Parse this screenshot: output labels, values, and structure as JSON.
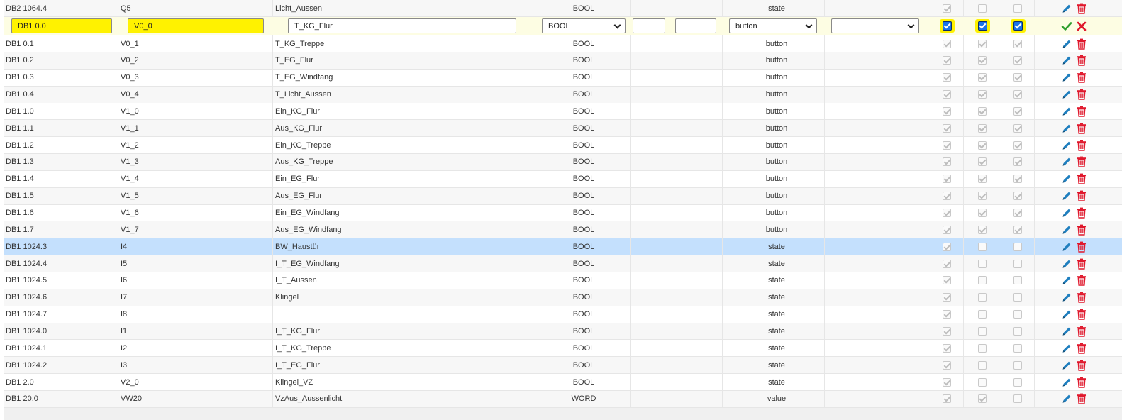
{
  "rows": [
    {
      "addr": "DB2 1064.4",
      "name": "Q5",
      "desc": "Licht_Aussen",
      "type": "BOOL",
      "kind": "state",
      "c1": true,
      "c2": false,
      "c3": false
    },
    {
      "addr": "DB1 0.1",
      "name": "V0_1",
      "desc": "T_KG_Treppe",
      "type": "BOOL",
      "kind": "button",
      "c1": true,
      "c2": true,
      "c3": true
    },
    {
      "addr": "DB1 0.2",
      "name": "V0_2",
      "desc": "T_EG_Flur",
      "type": "BOOL",
      "kind": "button",
      "c1": true,
      "c2": true,
      "c3": true
    },
    {
      "addr": "DB1 0.3",
      "name": "V0_3",
      "desc": "T_EG_Windfang",
      "type": "BOOL",
      "kind": "button",
      "c1": true,
      "c2": true,
      "c3": true
    },
    {
      "addr": "DB1 0.4",
      "name": "V0_4",
      "desc": "T_Licht_Aussen",
      "type": "BOOL",
      "kind": "button",
      "c1": true,
      "c2": true,
      "c3": true
    },
    {
      "addr": "DB1 1.0",
      "name": "V1_0",
      "desc": "Ein_KG_Flur",
      "type": "BOOL",
      "kind": "button",
      "c1": true,
      "c2": true,
      "c3": true
    },
    {
      "addr": "DB1 1.1",
      "name": "V1_1",
      "desc": "Aus_KG_Flur",
      "type": "BOOL",
      "kind": "button",
      "c1": true,
      "c2": true,
      "c3": true
    },
    {
      "addr": "DB1 1.2",
      "name": "V1_2",
      "desc": "Ein_KG_Treppe",
      "type": "BOOL",
      "kind": "button",
      "c1": true,
      "c2": true,
      "c3": true
    },
    {
      "addr": "DB1 1.3",
      "name": "V1_3",
      "desc": "Aus_KG_Treppe",
      "type": "BOOL",
      "kind": "button",
      "c1": true,
      "c2": true,
      "c3": true
    },
    {
      "addr": "DB1 1.4",
      "name": "V1_4",
      "desc": "Ein_EG_Flur",
      "type": "BOOL",
      "kind": "button",
      "c1": true,
      "c2": true,
      "c3": true
    },
    {
      "addr": "DB1 1.5",
      "name": "V1_5",
      "desc": "Aus_EG_Flur",
      "type": "BOOL",
      "kind": "button",
      "c1": true,
      "c2": true,
      "c3": true
    },
    {
      "addr": "DB1 1.6",
      "name": "V1_6",
      "desc": "Ein_EG_Windfang",
      "type": "BOOL",
      "kind": "button",
      "c1": true,
      "c2": true,
      "c3": true
    },
    {
      "addr": "DB1 1.7",
      "name": "V1_7",
      "desc": "Aus_EG_Windfang",
      "type": "BOOL",
      "kind": "button",
      "c1": true,
      "c2": true,
      "c3": true
    },
    {
      "addr": "DB1 1024.3",
      "name": "I4",
      "desc": "BW_Haustür",
      "type": "BOOL",
      "kind": "state",
      "c1": true,
      "c2": false,
      "c3": false,
      "selected": true
    },
    {
      "addr": "DB1 1024.4",
      "name": "I5",
      "desc": "I_T_EG_Windfang",
      "type": "BOOL",
      "kind": "state",
      "c1": true,
      "c2": false,
      "c3": false
    },
    {
      "addr": "DB1 1024.5",
      "name": "I6",
      "desc": "I_T_Aussen",
      "type": "BOOL",
      "kind": "state",
      "c1": true,
      "c2": false,
      "c3": false
    },
    {
      "addr": "DB1 1024.6",
      "name": "I7",
      "desc": "Klingel",
      "type": "BOOL",
      "kind": "state",
      "c1": true,
      "c2": false,
      "c3": false
    },
    {
      "addr": "DB1 1024.7",
      "name": "I8",
      "desc": "",
      "type": "BOOL",
      "kind": "state",
      "c1": true,
      "c2": false,
      "c3": false
    },
    {
      "addr": "DB1 1024.0",
      "name": "I1",
      "desc": "I_T_KG_Flur",
      "type": "BOOL",
      "kind": "state",
      "c1": true,
      "c2": false,
      "c3": false
    },
    {
      "addr": "DB1 1024.1",
      "name": "I2",
      "desc": "I_T_KG_Treppe",
      "type": "BOOL",
      "kind": "state",
      "c1": true,
      "c2": false,
      "c3": false
    },
    {
      "addr": "DB1 1024.2",
      "name": "I3",
      "desc": "I_T_EG_Flur",
      "type": "BOOL",
      "kind": "state",
      "c1": true,
      "c2": false,
      "c3": false
    },
    {
      "addr": "DB1 2.0",
      "name": "V2_0",
      "desc": "Klingel_VZ",
      "type": "BOOL",
      "kind": "state",
      "c1": true,
      "c2": false,
      "c3": false
    },
    {
      "addr": "DB1 20.0",
      "name": "VW20",
      "desc": "VzAus_Aussenlicht",
      "type": "WORD",
      "kind": "value",
      "c1": true,
      "c2": true,
      "c3": false
    }
  ],
  "edit_row": {
    "addr": "DB1 0.0",
    "name": "V0_0",
    "desc": "T_KG_Flur",
    "type": "BOOL",
    "field5": "",
    "field6": "",
    "kind": "button",
    "extra": "",
    "c1": true,
    "c2": true,
    "c3": true
  },
  "colors": {
    "highlight": "#fff200",
    "selected_row": "#c4e0fd",
    "edit_icon": "#1f7fbf",
    "delete_icon": "#e0192d",
    "confirm": "#2e9e2e",
    "cancel": "#e0192d"
  },
  "icons": {
    "edit": "pencil-icon",
    "delete": "trash-icon",
    "confirm": "check-icon",
    "cancel": "close-icon"
  }
}
